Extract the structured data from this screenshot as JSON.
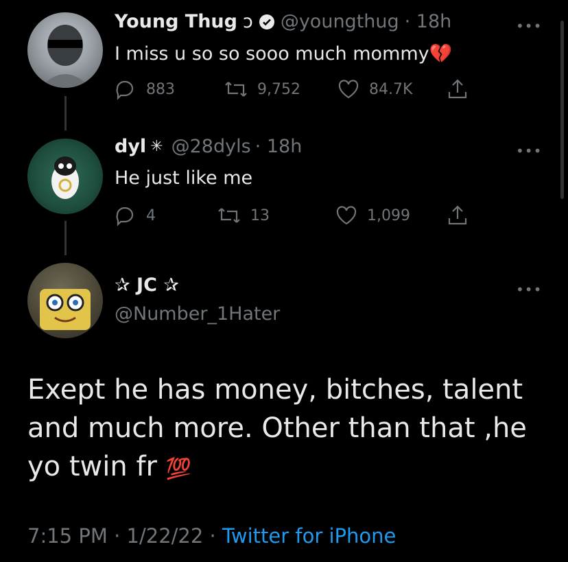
{
  "tweets": [
    {
      "name": "Young Thug",
      "name_suffix": "ↄ",
      "handle": "@youngthug",
      "time": "· 18h",
      "text": "I miss u so so sooo much mommy",
      "emoji": "💔",
      "replies": "883",
      "retweets": "9,752",
      "likes": "84.7K"
    },
    {
      "name": "dyl",
      "name_suffix": "✳",
      "handle": "@28dyls",
      "time": "· 18h",
      "text": "He just like me",
      "replies": "4",
      "retweets": "13",
      "likes": "1,099"
    }
  ],
  "main_tweet": {
    "name": "✰ JC ✰",
    "handle": "@Number_1Hater",
    "text": "Exept he has money, bitches, talent and much more. Other than that ,he yo twin fr",
    "emoji": "💯",
    "time": "7:15 PM",
    "date": "1/22/22",
    "source": "Twitter for iPhone"
  },
  "icons": {
    "more": "more-icon",
    "reply": "reply-icon",
    "retweet": "retweet-icon",
    "like": "like-icon",
    "share": "share-icon",
    "verified": "verified-badge-icon"
  },
  "colors": {
    "background": "#000000",
    "text": "#e7e9ea",
    "muted": "#71767b",
    "link": "#1d9bf0"
  }
}
